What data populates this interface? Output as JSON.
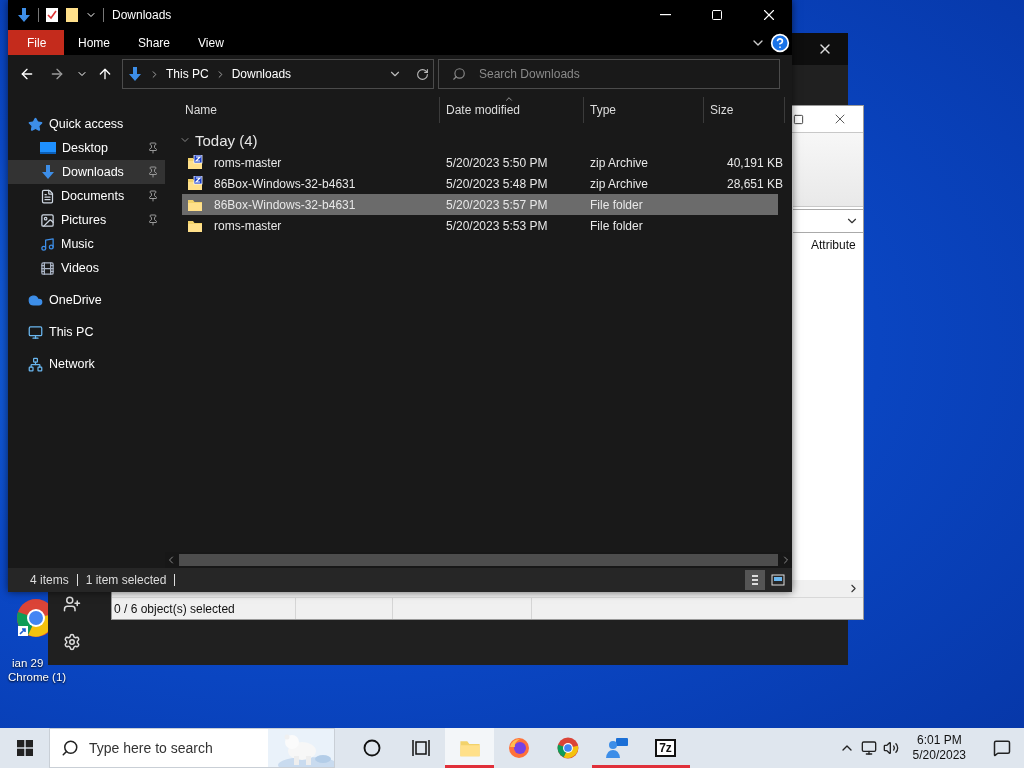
{
  "desktop_icons": [
    {
      "lines": [
        "ian 29",
        "Chrome (1)"
      ]
    }
  ],
  "zip_window": {
    "column_header": "Attribute",
    "status": "0 / 6 object(s) selected"
  },
  "explorer": {
    "title": "Downloads",
    "ribbon_tabs": [
      {
        "label": "File",
        "kind": "file"
      },
      {
        "label": "Home",
        "kind": "tab"
      },
      {
        "label": "Share",
        "kind": "tab"
      },
      {
        "label": "View",
        "kind": "tab"
      }
    ],
    "address": {
      "path": [
        "This PC",
        "Downloads"
      ]
    },
    "search": {
      "placeholder": "Search Downloads"
    },
    "nav": [
      {
        "label": "Quick access",
        "kind": "star",
        "selected": false,
        "children": [
          {
            "label": "Desktop",
            "kind": "desktop",
            "selected": false,
            "pinned": true
          },
          {
            "label": "Downloads",
            "kind": "downloads",
            "selected": true,
            "pinned": true
          },
          {
            "label": "Documents",
            "kind": "documents",
            "selected": false,
            "pinned": true
          },
          {
            "label": "Pictures",
            "kind": "pictures",
            "selected": false,
            "pinned": true
          },
          {
            "label": "Music",
            "kind": "music",
            "selected": false,
            "pinned": false
          },
          {
            "label": "Videos",
            "kind": "videos",
            "selected": false,
            "pinned": false
          }
        ]
      },
      {
        "label": "OneDrive",
        "kind": "cloud",
        "selected": false
      },
      {
        "label": "This PC",
        "kind": "pc",
        "selected": false
      },
      {
        "label": "Network",
        "kind": "network",
        "selected": false
      }
    ],
    "columns": [
      {
        "label": "Name",
        "sorted": false
      },
      {
        "label": "Date modified",
        "sorted": true
      },
      {
        "label": "Type",
        "sorted": false
      },
      {
        "label": "Size",
        "sorted": false
      }
    ],
    "group": {
      "label": "Today (4)",
      "expanded": true
    },
    "rows": [
      {
        "name": "roms-master",
        "date": "5/20/2023 5:50 PM",
        "type": "zip Archive",
        "size": "40,191 KB",
        "kind": "zip",
        "selected": false
      },
      {
        "name": "86Box-Windows-32-b4631",
        "date": "5/20/2023 5:48 PM",
        "type": "zip Archive",
        "size": "28,651 KB",
        "kind": "zip",
        "selected": false
      },
      {
        "name": "86Box-Windows-32-b4631",
        "date": "5/20/2023 5:57 PM",
        "type": "File folder",
        "kind": "folder",
        "selected": true
      },
      {
        "name": "roms-master",
        "date": "5/20/2023 5:53 PM",
        "type": "File folder",
        "kind": "folder",
        "selected": false
      }
    ],
    "status": {
      "count": "4 items",
      "selection": "1 item selected"
    },
    "views": [
      {
        "kind": "details",
        "selected": true
      },
      {
        "kind": "tiles",
        "selected": false
      }
    ]
  },
  "taskbar": {
    "search_placeholder": "Type here to search",
    "apps": [
      {
        "kind": "cortana",
        "running": false,
        "active": false
      },
      {
        "kind": "taskview",
        "running": false,
        "active": false
      },
      {
        "kind": "explorer",
        "running": true,
        "active": true
      },
      {
        "kind": "firefox",
        "running": false,
        "active": false
      },
      {
        "kind": "chrome",
        "running": false,
        "active": false
      },
      {
        "kind": "people",
        "running": true,
        "active": false
      },
      {
        "kind": "sevenzip",
        "label": "7z",
        "running": true,
        "active": false
      }
    ],
    "time": "6:01 PM",
    "date": "5/20/2023"
  }
}
